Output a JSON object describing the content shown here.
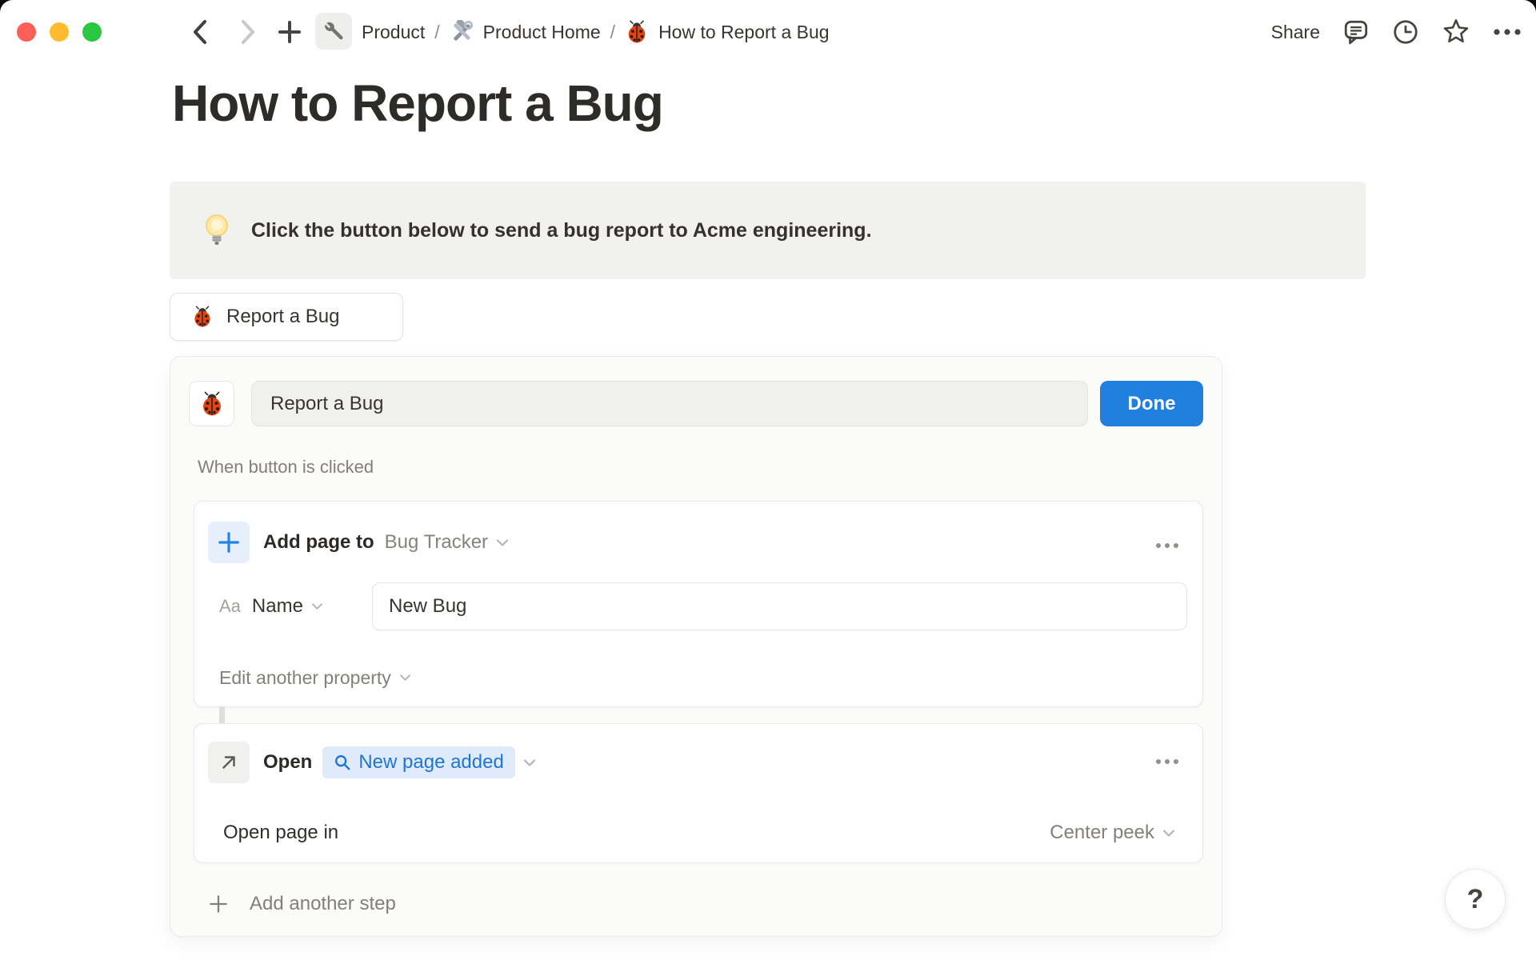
{
  "titlebar": {
    "separator": "/",
    "breadcrumb": [
      {
        "label": "Product"
      },
      {
        "label": "Product Home"
      },
      {
        "label": "How to Report a Bug"
      }
    ],
    "share_label": "Share"
  },
  "page": {
    "title": "How to Report a Bug",
    "callout_text": "Click the button below to send a bug report to Acme engineering.",
    "report_button_label": "Report a Bug"
  },
  "editor": {
    "button_name_value": "Report a Bug",
    "done_label": "Done",
    "trigger_label": "When button is clicked",
    "step1": {
      "action_label": "Add page to",
      "target_value": "Bug Tracker",
      "property_type": "Aa",
      "property_name": "Name",
      "property_value": "New Bug",
      "edit_property_label": "Edit another property"
    },
    "step2": {
      "action_label": "Open",
      "target_value": "New page added",
      "open_in_label": "Open page in",
      "open_in_value": "Center peek"
    },
    "add_step_label": "Add another step"
  },
  "help_label": "?",
  "colors": {
    "accent_blue": "#1f80e0",
    "pill_bg": "#dfeafa",
    "pill_text": "#2076d2",
    "callout_bg": "#f1f1ef",
    "traffic_red": "#ff5f57",
    "traffic_yellow": "#febc2e",
    "traffic_green": "#28c840"
  }
}
